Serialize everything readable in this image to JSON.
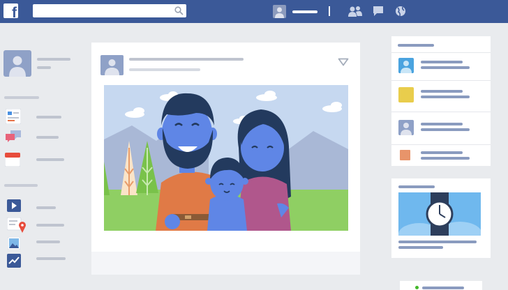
{
  "topbar": {
    "logo_letter": "f"
  },
  "colors": {
    "brand": "#3b5998",
    "background": "#e9ebee",
    "card": "#ffffff",
    "sky": "#c6d8f0",
    "grass": "#8fcf63"
  },
  "icons": [
    "search-icon",
    "friends-icon",
    "messages-icon",
    "notifications-globe-icon",
    "post-menu-chevron-icon",
    "video-icon",
    "location-pin-icon",
    "photos-icon",
    "insights-icon",
    "clock-icon"
  ]
}
